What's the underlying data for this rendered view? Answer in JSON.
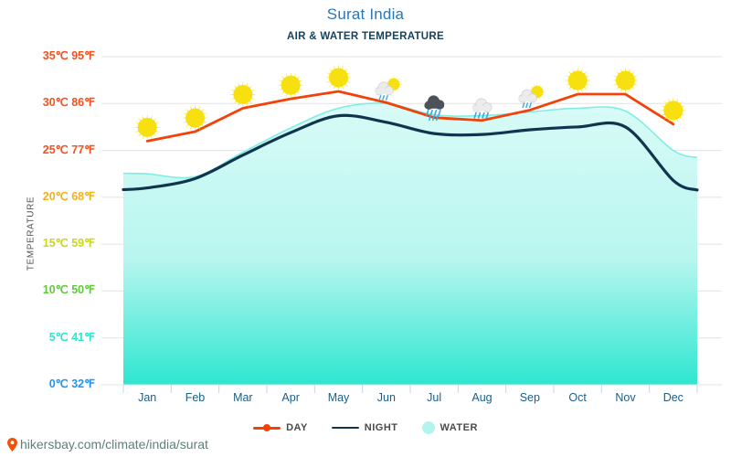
{
  "header": {
    "title": "Surat India",
    "subtitle": "AIR & WATER TEMPERATURE",
    "title_color": "#2a77b5",
    "subtitle_color": "#16425b"
  },
  "footer": {
    "url": "hikersbay.com/climate/india/surat",
    "pin_icon": "map-pin-icon",
    "url_color": "#5f7f7a",
    "pin_color": "#f1520a"
  },
  "legend": {
    "position": "bottom-center",
    "items": [
      {
        "label": "DAY",
        "color": "#f1420a",
        "marker": "line-with-dot"
      },
      {
        "label": "NIGHT",
        "color": "#12354f",
        "marker": "line"
      },
      {
        "label": "WATER",
        "color": "#b2f5ef",
        "marker": "circle"
      }
    ]
  },
  "axes": {
    "y_title": "TEMPERATURE",
    "y_ticks": [
      {
        "label": "35℃ 95℉",
        "c": 35,
        "f": 95,
        "color": "#f4511e"
      },
      {
        "label": "30℃ 86℉",
        "c": 30,
        "f": 86,
        "color": "#f4511e"
      },
      {
        "label": "25℃ 77℉",
        "c": 25,
        "f": 77,
        "color": "#f4511e"
      },
      {
        "label": "20℃ 68℉",
        "c": 20,
        "f": 68,
        "color": "#f0b21a"
      },
      {
        "label": "15℃ 59℉",
        "c": 15,
        "f": 59,
        "color": "#c8d719"
      },
      {
        "label": "10℃ 50℉",
        "c": 10,
        "f": 50,
        "color": "#5ecb3a"
      },
      {
        "label": "5℃ 41℉",
        "c": 5,
        "f": 41,
        "color": "#2ee6d0"
      },
      {
        "label": "0℃ 32℉",
        "c": 0,
        "f": 32,
        "color": "#2196f3"
      }
    ],
    "x_ticks": [
      "Jan",
      "Feb",
      "Mar",
      "Apr",
      "May",
      "Jun",
      "Jul",
      "Aug",
      "Sep",
      "Oct",
      "Nov",
      "Dec"
    ],
    "x_tick_color": "#1a5e8a",
    "grid": true,
    "grid_color": "#e3e3e3",
    "ylim": [
      0,
      35
    ]
  },
  "chart_data": {
    "type": "line",
    "title": "Surat India — AIR & WATER TEMPERATURE",
    "xlabel": "",
    "ylabel": "TEMPERATURE",
    "ylim": [
      0,
      35
    ],
    "yunit": "°C",
    "grid": true,
    "legend_position": "bottom-center",
    "categories": [
      "Jan",
      "Feb",
      "Mar",
      "Apr",
      "May",
      "Jun",
      "Jul",
      "Aug",
      "Sep",
      "Oct",
      "Nov",
      "Dec"
    ],
    "series": [
      {
        "name": "DAY",
        "color": "#f1420a",
        "type": "line",
        "values": [
          26.0,
          27.0,
          29.5,
          30.5,
          31.3,
          30.1,
          28.5,
          28.2,
          29.3,
          31.0,
          31.0,
          27.8
        ]
      },
      {
        "name": "NIGHT",
        "color": "#12354f",
        "type": "line",
        "values": [
          21.0,
          22.0,
          24.5,
          26.9,
          28.7,
          28.0,
          26.8,
          26.7,
          27.2,
          27.5,
          27.5,
          21.8
        ]
      },
      {
        "name": "WATER",
        "color": "#b2f5ef",
        "type": "area",
        "values": [
          22.5,
          22.2,
          24.8,
          27.4,
          29.5,
          30.0,
          28.8,
          28.7,
          29.1,
          29.5,
          29.2,
          25.0
        ]
      }
    ],
    "weather_icons": [
      {
        "month": "Jan",
        "icon": "sun-icon",
        "value": 26.0
      },
      {
        "month": "Feb",
        "icon": "sun-icon",
        "value": 27.0
      },
      {
        "month": "Mar",
        "icon": "sun-icon",
        "value": 29.5
      },
      {
        "month": "Apr",
        "icon": "sun-icon",
        "value": 30.5
      },
      {
        "month": "May",
        "icon": "sun-icon",
        "value": 31.3
      },
      {
        "month": "Jun",
        "icon": "sun-behind-rain-cloud-icon",
        "value": 30.1
      },
      {
        "month": "Jul",
        "icon": "heavy-rain-cloud-icon",
        "value": 28.5
      },
      {
        "month": "Aug",
        "icon": "rain-cloud-icon",
        "value": 28.2
      },
      {
        "month": "Sep",
        "icon": "sun-behind-rain-cloud-icon",
        "value": 29.3
      },
      {
        "month": "Oct",
        "icon": "sun-icon",
        "value": 31.0
      },
      {
        "month": "Nov",
        "icon": "sun-icon",
        "value": 31.0
      },
      {
        "month": "Dec",
        "icon": "sun-icon",
        "value": 27.8
      }
    ]
  }
}
